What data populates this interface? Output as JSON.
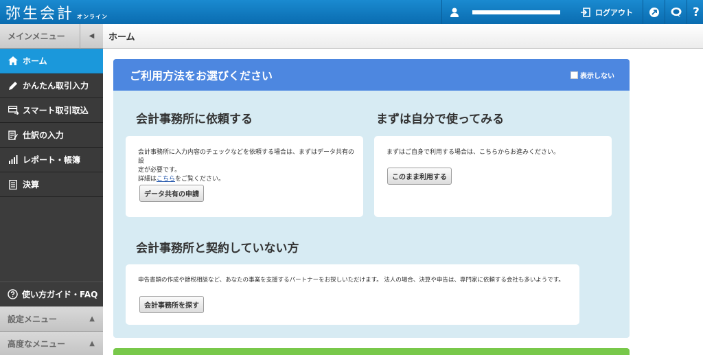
{
  "header": {
    "logo_main": "弥生会計",
    "logo_sub": "オンライン",
    "logout_label": "ログアウト",
    "help_label": "?"
  },
  "sidebar": {
    "main_menu_label": "メインメニュー",
    "items": [
      {
        "label": "ホーム",
        "icon": "home-icon",
        "active": true
      },
      {
        "label": "かんたん取引入力",
        "icon": "pencil-icon"
      },
      {
        "label": "スマート取引取込",
        "icon": "card-import-icon"
      },
      {
        "label": "仕訳の入力",
        "icon": "journal-icon"
      },
      {
        "label": "レポート・帳簿",
        "icon": "bar-chart-icon"
      },
      {
        "label": "決算",
        "icon": "document-icon"
      }
    ],
    "guide_label": "使い方ガイド・FAQ",
    "settings_menu_label": "設定メニュー",
    "advanced_menu_label": "高度なメニュー"
  },
  "breadcrumb": {
    "title": "ホーム"
  },
  "panel": {
    "title": "ご利用方法をお選びください",
    "hide_label": "表示しない",
    "request": {
      "title": "会計事務所に依頼する",
      "desc_line1": "会計事務所に入力内容のチェックなどを依頼する場合は、まずはデータ共有の設",
      "desc_line2": "定が必要です。",
      "desc_pre": "詳細は",
      "link": "こちら",
      "desc_post": "をご覧ください。",
      "button": "データ共有の申請"
    },
    "self": {
      "title": "まずは自分で使ってみる",
      "desc": "まずはご自身で利用する場合は、こちらからお進みください。",
      "button": "このまま利用する"
    },
    "no_contract": {
      "title": "会計事務所と契約していない方",
      "desc": "申告書類の作成や節税相談など、あなたの事業を支援するパートナーをお探しいただけます。 法人の場合、決算や申告は、専門家に依頼する会社も多いようです。",
      "button": "会計事務所を探す"
    }
  },
  "colors": {
    "topbar": "#0a6cb0",
    "sidebar_active": "#1b98db",
    "panel_header": "#4d87e0",
    "panel_bg": "#d7ebf3",
    "green_bar": "#78c84a"
  }
}
